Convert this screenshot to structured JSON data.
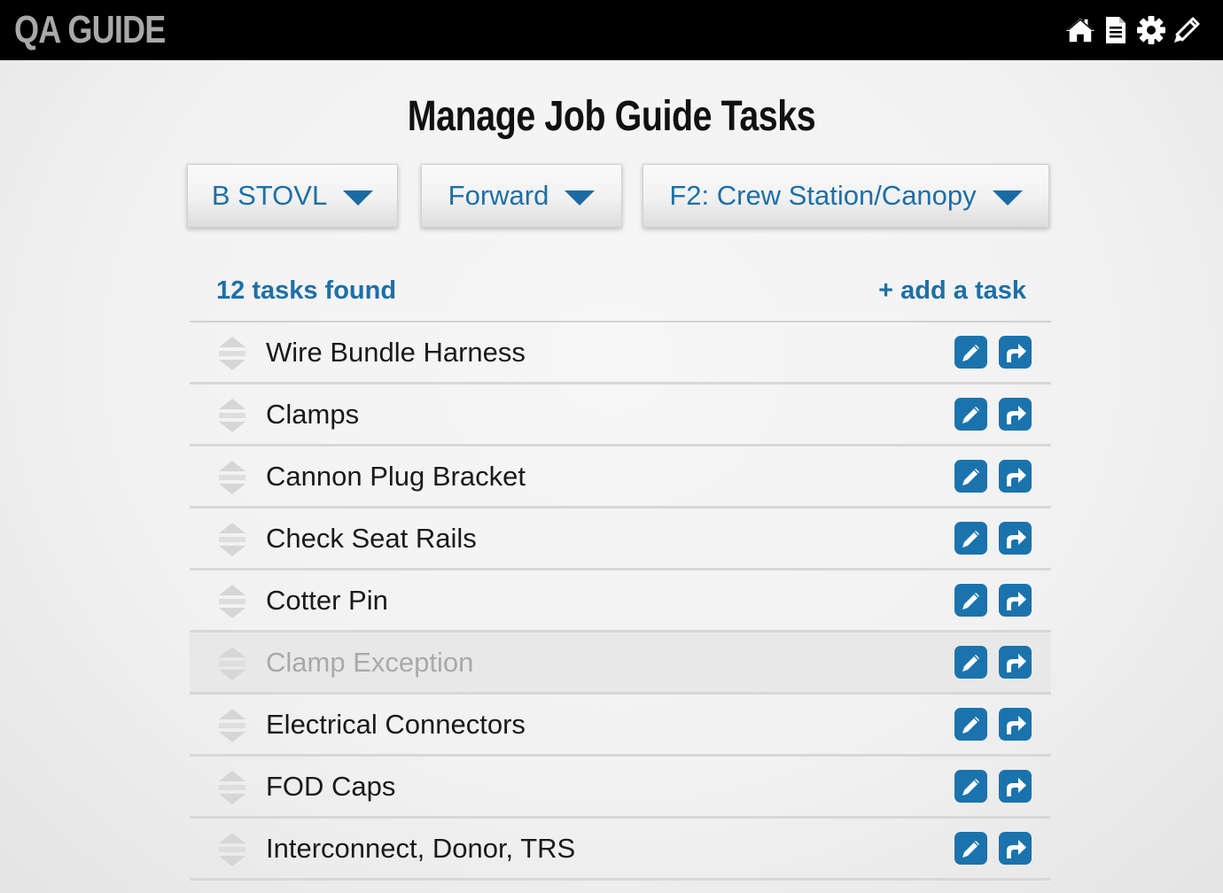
{
  "app": {
    "logo": "QA GUIDE",
    "nav_icons": [
      "home-icon",
      "document-icon",
      "gear-icon",
      "pencil-icon"
    ]
  },
  "page": {
    "title": "Manage Job Guide Tasks"
  },
  "filters": {
    "variant": "B STOVL",
    "section": "Forward",
    "station": "F2: Crew Station/Canopy"
  },
  "tasks_header": {
    "count_label": "12 tasks found",
    "add_label": "+ add a task"
  },
  "tasks": [
    {
      "name": "Wire Bundle Harness",
      "disabled": false
    },
    {
      "name": "Clamps",
      "disabled": false
    },
    {
      "name": "Cannon Plug Bracket",
      "disabled": false
    },
    {
      "name": "Check Seat Rails",
      "disabled": false
    },
    {
      "name": "Cotter Pin",
      "disabled": false
    },
    {
      "name": "Clamp Exception",
      "disabled": true
    },
    {
      "name": "Electrical Connectors",
      "disabled": false
    },
    {
      "name": "FOD Caps",
      "disabled": false
    },
    {
      "name": "Interconnect, Donor, TRS",
      "disabled": false
    }
  ],
  "colors": {
    "accent": "#1e6fa6",
    "icon_button": "#1b73ad",
    "topbar": "#000000"
  }
}
